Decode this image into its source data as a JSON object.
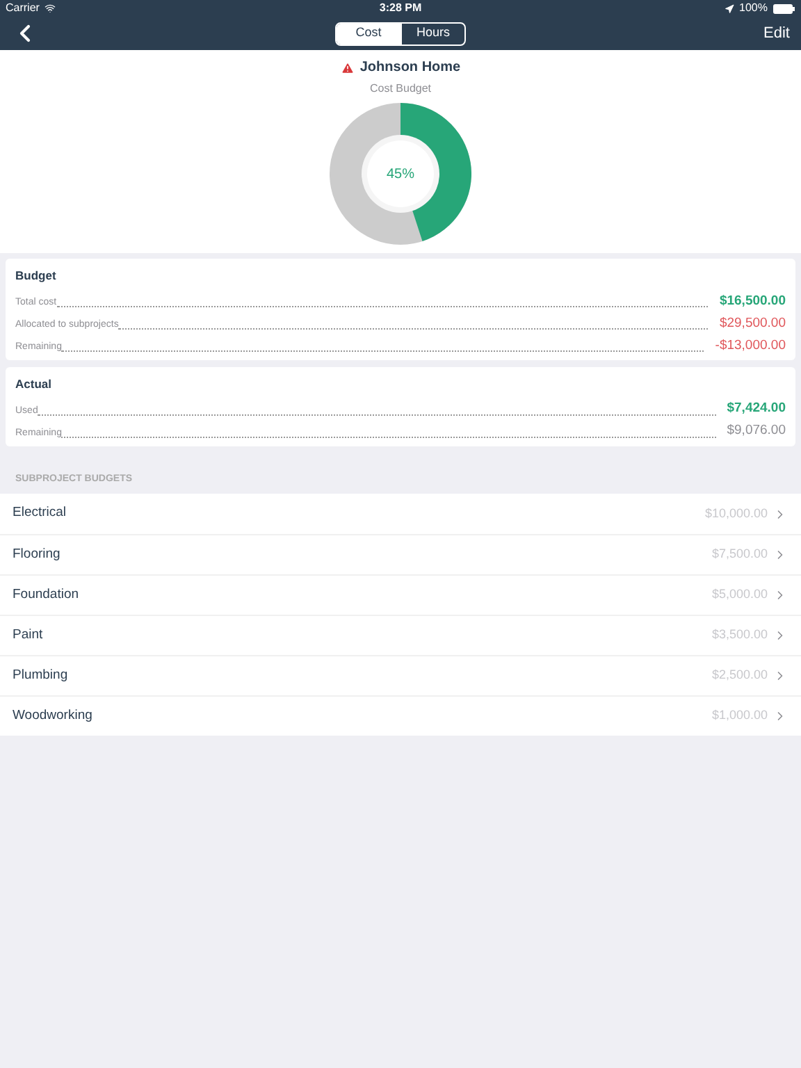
{
  "status_bar": {
    "carrier": "Carrier",
    "time": "3:28 PM",
    "battery": "100%"
  },
  "nav": {
    "tabs": [
      {
        "label": "Cost",
        "selected": true
      },
      {
        "label": "Hours",
        "selected": false
      }
    ],
    "edit": "Edit"
  },
  "project": {
    "title": "Johnson Home",
    "warning": true,
    "subtitle": "Cost Budget",
    "meter": {
      "level": 0.45,
      "reading": "45%"
    }
  },
  "cards": [
    {
      "title": "Budget",
      "rows": [
        {
          "label": "Total cost",
          "value": "$16,500.00",
          "color": "#27a678",
          "bold": true
        },
        {
          "label": "Allocated to subprojects",
          "value": "$29,500.00",
          "color": "#e0575b",
          "bold": false
        },
        {
          "label": "Remaining",
          "value": "-$13,000.00",
          "color": "#e0575b",
          "bold": false
        }
      ]
    },
    {
      "title": "Actual",
      "rows": [
        {
          "label": "Used",
          "value": "$7,424.00",
          "color": "#27a678",
          "bold": true
        },
        {
          "label": "Remaining",
          "value": "$9,076.00",
          "color": "#8e8e93",
          "bold": false
        }
      ]
    }
  ],
  "subprojects": {
    "header": "SUBPROJECT BUDGETS",
    "items": [
      {
        "name": "Electrical",
        "amount": "$10,000.00"
      },
      {
        "name": "Flooring",
        "amount": "$7,500.00"
      },
      {
        "name": "Foundation",
        "amount": "$5,000.00"
      },
      {
        "name": "Paint",
        "amount": "$3,500.00"
      },
      {
        "name": "Plumbing",
        "amount": "$2,500.00"
      },
      {
        "name": "Woodworking",
        "amount": "$1,000.00"
      }
    ]
  }
}
